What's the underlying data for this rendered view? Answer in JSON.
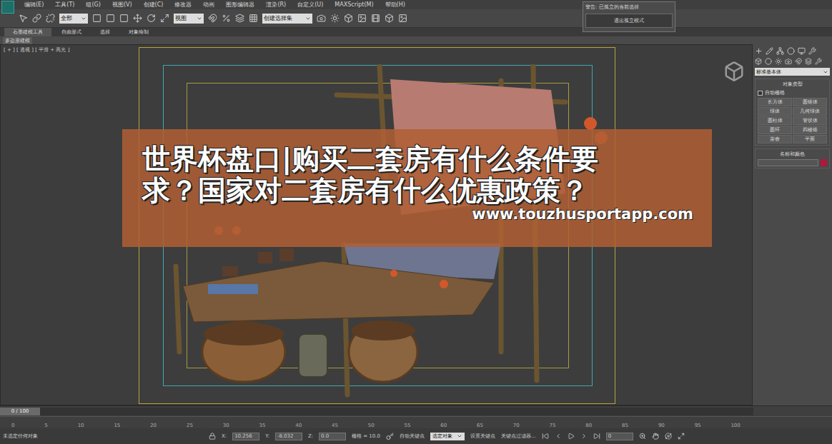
{
  "menu": [
    "编辑(E)",
    "工具(T)",
    "组(G)",
    "视图(V)",
    "创建(C)",
    "修改器",
    "动画",
    "图形编辑器",
    "渲染(R)",
    "自定义(U)",
    "MAXScript(M)",
    "帮助(H)"
  ],
  "toolbar": {
    "selection_filter": "全部",
    "reference": "视图",
    "named_selection": "创建选择集"
  },
  "ribbon_tabs": [
    {
      "label": "石墨建模工具",
      "selected": true
    },
    {
      "label": "自由形式",
      "selected": false
    },
    {
      "label": "选择",
      "selected": false
    },
    {
      "label": "对象绘制",
      "selected": false
    }
  ],
  "ribbon_panel": "多边形建模",
  "viewport": {
    "label": "[ + ] [ 透视 ] [ 平滑 + 高光 ]"
  },
  "banner": {
    "lines": [
      "世界杯盘口|购买二套房有什么条件要",
      "求？国家对二套房有什么优惠政策？"
    ],
    "url": "www.touzhusportapp.com"
  },
  "warning": {
    "title": "警告: 已孤立的当前选择",
    "button": "退出孤立模式"
  },
  "command_panel": {
    "dropdown": "标准基本体",
    "rollout": "对象类型",
    "auto_grid": {
      "label": "自动栅格",
      "checked": false
    },
    "buttons": [
      "长方体",
      "圆锥体",
      "球体",
      "几何球体",
      "圆柱体",
      "管状体",
      "圆环",
      "四棱锥",
      "茶壶",
      "平面"
    ],
    "name_rollout": "名称和颜色",
    "color": "#b0173a"
  },
  "timeline": {
    "frame": "0 / 100",
    "level": 0,
    "ticks": [
      "0",
      "5",
      "10",
      "15",
      "20",
      "25",
      "30",
      "35",
      "40",
      "45",
      "50",
      "55",
      "60",
      "65",
      "70",
      "75",
      "80",
      "85",
      "90",
      "95",
      "100"
    ]
  },
  "status": {
    "message": "未选定任何对象",
    "x": "10.256",
    "y": "-8.032",
    "z": "0.0",
    "grid": "栅格 = 10.0",
    "auto_key": "自动关键点",
    "key_mode": "选定对象",
    "set_key": "设置关键点",
    "key_filter": "关键点过滤器...",
    "frame": "0"
  }
}
